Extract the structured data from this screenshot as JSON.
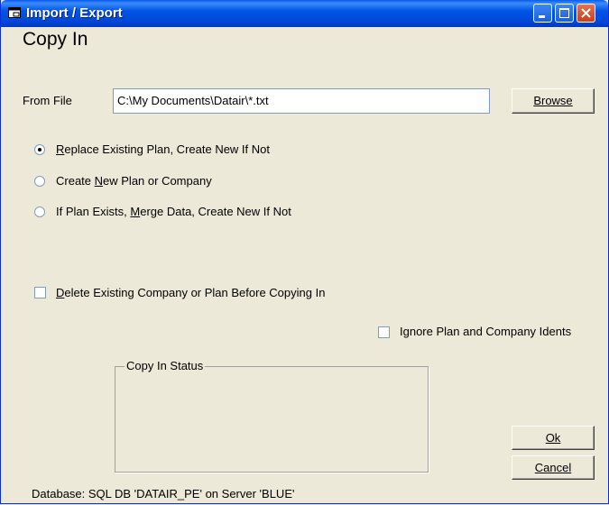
{
  "window": {
    "title": "Import / Export"
  },
  "heading": "Copy In",
  "from_file": {
    "label": "From File",
    "value": "C:\\My Documents\\Datair\\*.txt"
  },
  "buttons": {
    "browse": "Browse",
    "ok": "Ok",
    "cancel": "Cancel"
  },
  "options": [
    {
      "pre": "",
      "key": "R",
      "post": "eplace Existing Plan, Create New If Not",
      "selected": true
    },
    {
      "pre": "Create ",
      "key": "N",
      "post": "ew Plan or Company",
      "selected": false
    },
    {
      "pre": "If Plan Exists, ",
      "key": "M",
      "post": "erge Data, Create New If Not",
      "selected": false
    }
  ],
  "delete_existing": {
    "pre": "",
    "key": "D",
    "post": "elete Existing Company or Plan Before Copying In",
    "checked": false
  },
  "ignore_idents": {
    "label": "Ignore Plan and Company Idents",
    "checked": false
  },
  "status_group": {
    "title": "Copy In Status"
  },
  "database_status": "Database: SQL DB  'DATAIR_PE' on Server 'BLUE'"
}
